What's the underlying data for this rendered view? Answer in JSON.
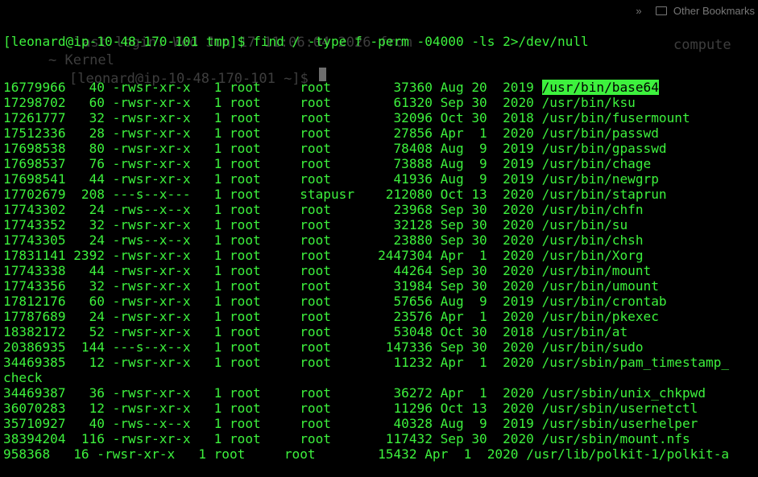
{
  "browser_ghost": {
    "other_bookmarks": "Other Bookmarks",
    "chevrons": "»",
    "ghost_lines": [
      "last login: Wed Jun 17 11:06:04 2026 from",
      "~ Kernel",
      "[leonard@ip-10-48-170-101 ~]$",
      "compute"
    ]
  },
  "terminal": {
    "prompt": "[leonard@ip-10-48-170-101 tmp]$ ",
    "command": "find / -type f -perm -04000 -ls 2>/dev/null",
    "rows": [
      {
        "text": "16779966   40 -rwsr-xr-x   1 root     root        37360 Aug 20  2019 ",
        "path": "/usr/bin/base64",
        "highlight": true
      },
      {
        "text": "17298702   60 -rwsr-xr-x   1 root     root        61320 Sep 30  2020 ",
        "path": "/usr/bin/ksu",
        "highlight": false
      },
      {
        "text": "17261777   32 -rwsr-xr-x   1 root     root        32096 Oct 30  2018 ",
        "path": "/usr/bin/fusermount",
        "highlight": false
      },
      {
        "text": "17512336   28 -rwsr-xr-x   1 root     root        27856 Apr  1  2020 ",
        "path": "/usr/bin/passwd",
        "highlight": false
      },
      {
        "text": "17698538   80 -rwsr-xr-x   1 root     root        78408 Aug  9  2019 ",
        "path": "/usr/bin/gpasswd",
        "highlight": false
      },
      {
        "text": "17698537   76 -rwsr-xr-x   1 root     root        73888 Aug  9  2019 ",
        "path": "/usr/bin/chage",
        "highlight": false
      },
      {
        "text": "17698541   44 -rwsr-xr-x   1 root     root        41936 Aug  9  2019 ",
        "path": "/usr/bin/newgrp",
        "highlight": false
      },
      {
        "text": "17702679  208 ---s--x---   1 root     stapusr    212080 Oct 13  2020 ",
        "path": "/usr/bin/staprun",
        "highlight": false
      },
      {
        "text": "17743302   24 -rws--x--x   1 root     root        23968 Sep 30  2020 ",
        "path": "/usr/bin/chfn",
        "highlight": false
      },
      {
        "text": "17743352   32 -rwsr-xr-x   1 root     root        32128 Sep 30  2020 ",
        "path": "/usr/bin/su",
        "highlight": false
      },
      {
        "text": "17743305   24 -rws--x--x   1 root     root        23880 Sep 30  2020 ",
        "path": "/usr/bin/chsh",
        "highlight": false
      },
      {
        "text": "17831141 2392 -rwsr-xr-x   1 root     root      2447304 Apr  1  2020 ",
        "path": "/usr/bin/Xorg",
        "highlight": false
      },
      {
        "text": "17743338   44 -rwsr-xr-x   1 root     root        44264 Sep 30  2020 ",
        "path": "/usr/bin/mount",
        "highlight": false
      },
      {
        "text": "17743356   32 -rwsr-xr-x   1 root     root        31984 Sep 30  2020 ",
        "path": "/usr/bin/umount",
        "highlight": false
      },
      {
        "text": "17812176   60 -rwsr-xr-x   1 root     root        57656 Aug  9  2019 ",
        "path": "/usr/bin/crontab",
        "highlight": false
      },
      {
        "text": "17787689   24 -rwsr-xr-x   1 root     root        23576 Apr  1  2020 ",
        "path": "/usr/bin/pkexec",
        "highlight": false
      },
      {
        "text": "18382172   52 -rwsr-xr-x   1 root     root        53048 Oct 30  2018 ",
        "path": "/usr/bin/at",
        "highlight": false
      },
      {
        "text": "20386935  144 ---s--x--x   1 root     root       147336 Sep 30  2020 ",
        "path": "/usr/bin/sudo",
        "highlight": false
      },
      {
        "text": "34469385   12 -rwsr-xr-x   1 root     root        11232 Apr  1  2020 ",
        "path": "/usr/sbin/pam_timestamp_",
        "highlight": false
      },
      {
        "text": "",
        "path": "check",
        "highlight": false
      },
      {
        "text": "34469387   36 -rwsr-xr-x   1 root     root        36272 Apr  1  2020 ",
        "path": "/usr/sbin/unix_chkpwd",
        "highlight": false
      },
      {
        "text": "36070283   12 -rwsr-xr-x   1 root     root        11296 Oct 13  2020 ",
        "path": "/usr/sbin/usernetctl",
        "highlight": false
      },
      {
        "text": "35710927   40 -rws--x--x   1 root     root        40328 Aug  9  2019 ",
        "path": "/usr/sbin/userhelper",
        "highlight": false
      },
      {
        "text": "38394204  116 -rwsr-xr-x   1 root     root       117432 Sep 30  2020 ",
        "path": "/usr/sbin/mount.nfs",
        "highlight": false
      },
      {
        "text": "958368   16 -rwsr-xr-x   1 root     root        15432 Apr  1  2020 ",
        "path": "/usr/lib/polkit-1/polkit-a",
        "highlight": false
      }
    ]
  },
  "colors": {
    "background": "#000000",
    "text": "#3df13d",
    "highlight_bg": "#3df13d",
    "highlight_fg": "#000000"
  }
}
